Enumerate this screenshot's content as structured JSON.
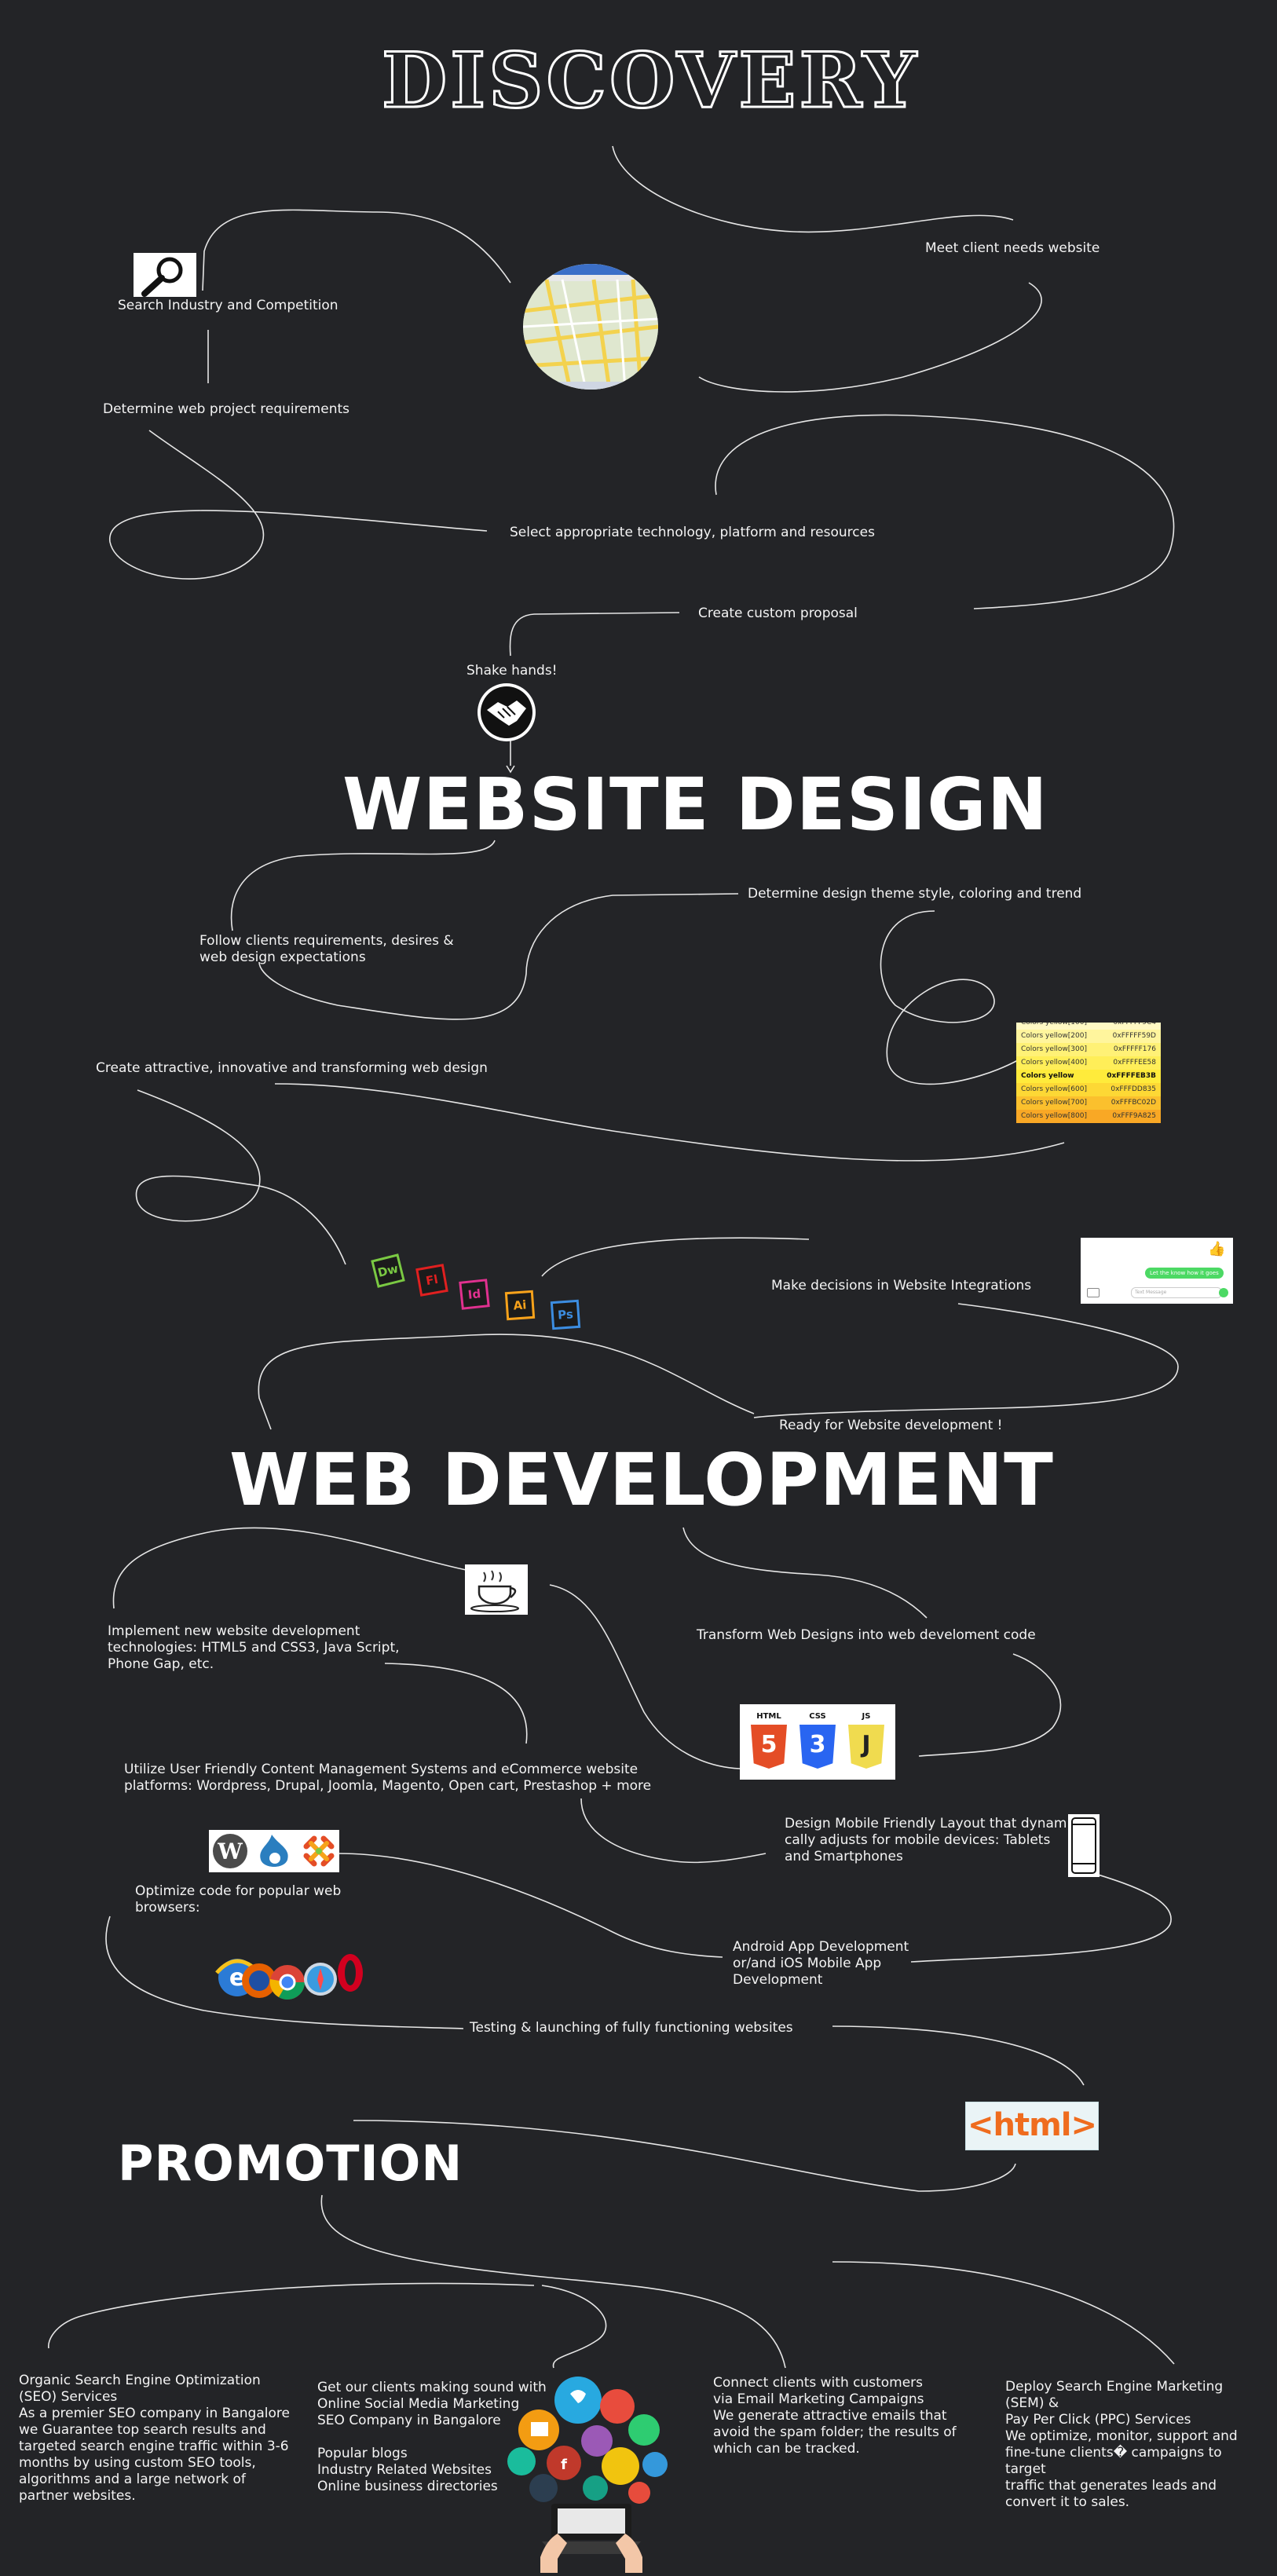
{
  "sections": {
    "discovery": "DISCOVERY",
    "design": "WEBSITE DESIGN",
    "development": "WEB DEVELOPMENT",
    "promotion": "PROMOTION"
  },
  "discovery": {
    "meet_client": "Meet client needs website",
    "search_industry": "Search Industry and Competition",
    "determine_requirements": "Determine web project requirements",
    "select_technology": "Select appropriate technology, platform and resources",
    "custom_proposal": "Create custom proposal",
    "shake_hands": "Shake hands!"
  },
  "design": {
    "theme_style": "Determine design theme style, coloring and trend",
    "follow_requirements": "Follow clients requirements, desires &\nweb design expectations",
    "attractive_design": "Create attractive, innovative and transforming web design",
    "integrations": "Make decisions in Website Integrations",
    "ready": "Ready for Website development !",
    "adobe_icons": [
      "Dw",
      "Fl",
      "Id",
      "Ai",
      "Ps"
    ],
    "adobe_colors": [
      "#7ac943",
      "#e02020",
      "#e0318f",
      "#f7a21b",
      "#3c8de0"
    ],
    "color_table": [
      [
        "Colors yellow[100]",
        "0xFFFFF9C4"
      ],
      [
        "Colors yellow[200]",
        "0xFFFFF59D"
      ],
      [
        "Colors yellow[300]",
        "0xFFFFF176"
      ],
      [
        "Colors yellow[400]",
        "0xFFFFEE58"
      ],
      [
        "Colors yellow",
        "0xFFFFEB3B"
      ],
      [
        "Colors yellow[600]",
        "0xFFFDD835"
      ],
      [
        "Colors yellow[700]",
        "0xFFFBC02D"
      ],
      [
        "Colors yellow[800]",
        "0xFFF9A825"
      ]
    ],
    "chat_bubble": "Let the know how it goes",
    "chat_placeholder": "Text Message"
  },
  "development": {
    "implement": "Implement new website development\ntechnologies: HTML5 and CSS3, Java Script,\nPhone Gap, etc.",
    "transform": "Transform Web Designs into web develoment code",
    "cms": "Utilize User Friendly Content Management Systems and eCommerce website\nplatforms: Wordpress, Drupal, Joomla, Magento, Open cart, Prestashop + more",
    "mobile_layout": "Design Mobile Friendly Layout that dynami-\ncally adjusts for mobile devices: Tablets\nand Smartphones",
    "optimize": "Optimize code for popular web\nbrowsers:",
    "android": "Android App Development\nor/and iOS Mobile App\nDevelopment",
    "testing": "Testing & launching of fully functioning websites",
    "html_badge": "<html>",
    "tech_badges": [
      "HTML",
      "CSS",
      "JS"
    ],
    "tech_numbers": [
      "5",
      "3",
      "J"
    ]
  },
  "promotion": {
    "seo": "Organic Search Engine Optimization\n(SEO) Services\nAs a premier SEO company in Bangalore\nwe Guarantee top search results and\ntargeted search engine traffic within 3-6\nmonths by using custom SEO tools,\nalgorithms and a large network of\npartner websites.",
    "social": "Get our clients making sound with\nOnline Social Media Marketing\nSEO Company in Bangalore\n\nPopular blogs\nIndustry Related Websites\nOnline business directories",
    "email": "Connect clients with customers\nvia Email Marketing Campaigns\nWe generate attractive emails that\navoid the spam folder; the results of\nwhich can be tracked.",
    "sem": "Deploy Search Engine Marketing\n(SEM) &\nPay Per Click (PPC) Services\nWe optimize, monitor, support and\nfine-tune clients� campaigns to\ntarget\ntraffic that generates leads and\nconvert it to sales."
  }
}
